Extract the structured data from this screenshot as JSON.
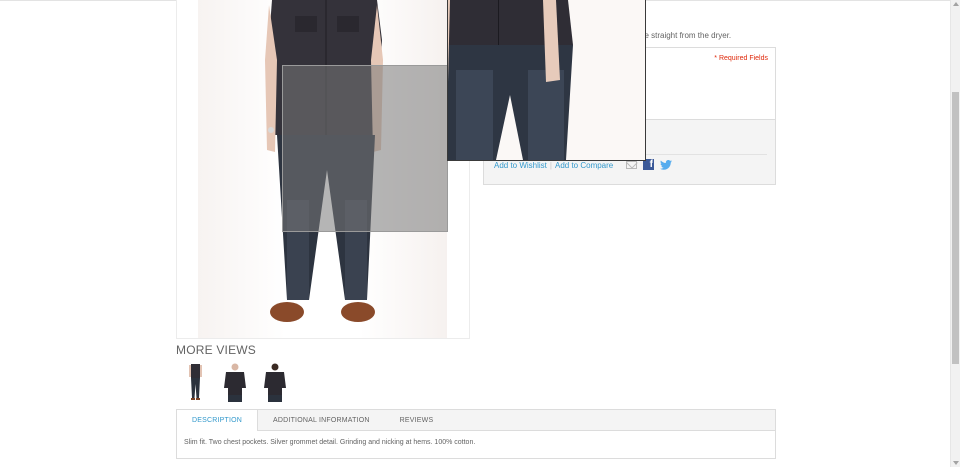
{
  "product": {
    "short_description_fragment": "ee straight from the dryer.",
    "required_fields_label": "* Required Fields",
    "add_to_wishlist_label": "Add to Wishlist",
    "separator": "|",
    "add_to_compare_label": "Add to Compare"
  },
  "share": {
    "icons": [
      "email-icon",
      "facebook-icon",
      "twitter-icon"
    ],
    "facebook_glyph": "f"
  },
  "more_views": {
    "title": "MORE VIEWS",
    "thumbnails": [
      "full-body-view",
      "front-shirt-view",
      "back-shirt-view"
    ]
  },
  "tabs": {
    "items": [
      {
        "label": "DESCRIPTION",
        "active": true
      },
      {
        "label": "ADDITIONAL INFORMATION",
        "active": false
      },
      {
        "label": "REVIEWS",
        "active": false
      }
    ],
    "content": "Slim fit. Two chest pockets. Silver grommet detail. Grinding and nicking at hems. 100% cotton."
  },
  "colors": {
    "link": "#3399cc",
    "required": "#df280a",
    "text": "#636363",
    "facebook": "#3b5998",
    "twitter": "#55acee"
  }
}
